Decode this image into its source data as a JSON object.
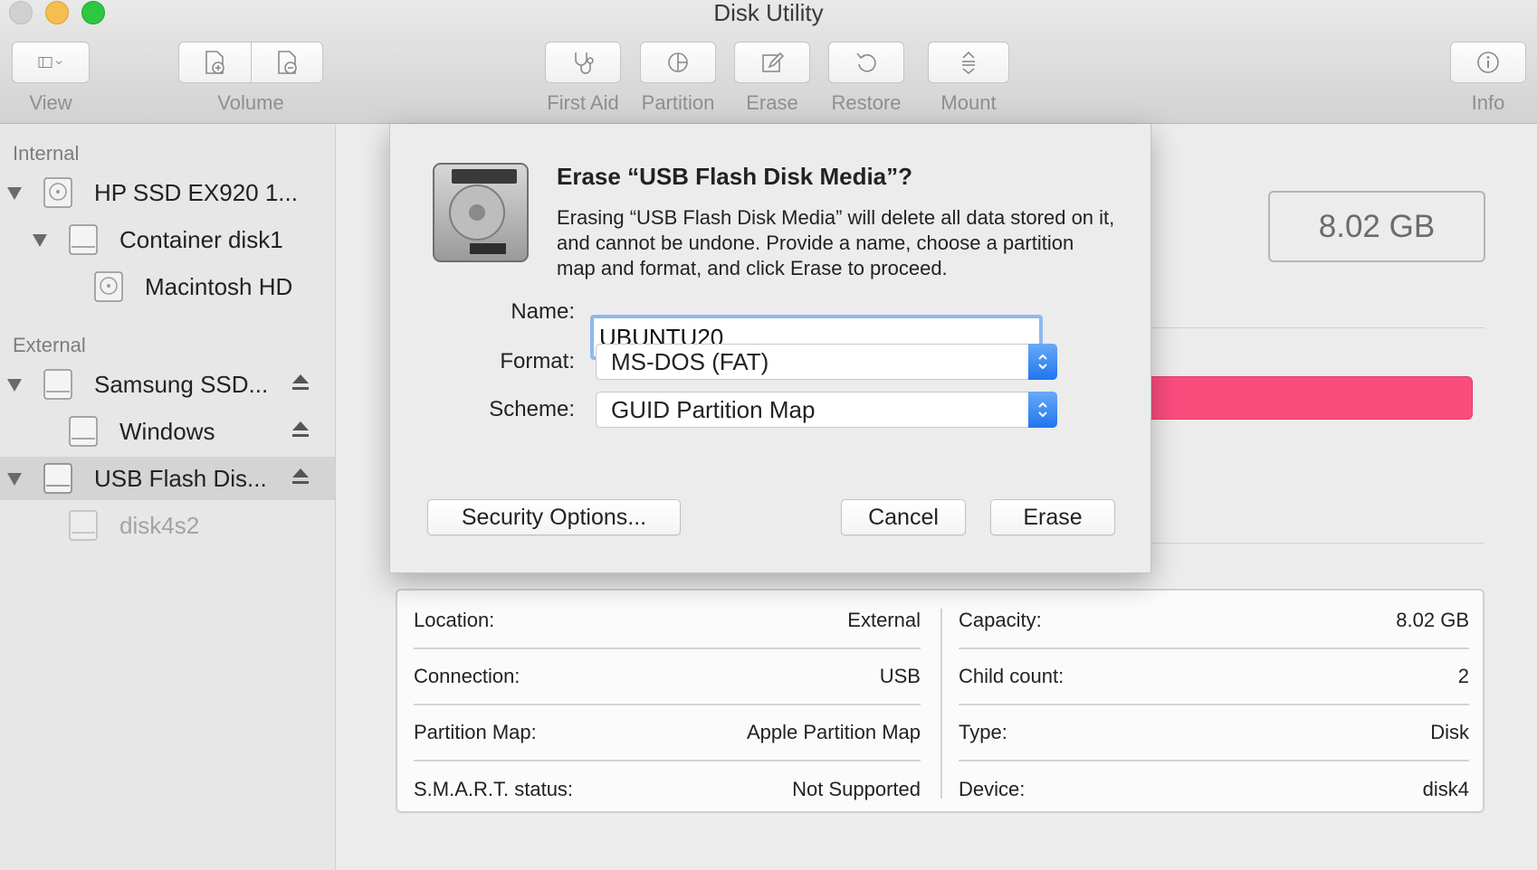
{
  "window": {
    "title": "Disk Utility"
  },
  "toolbar": {
    "view_label": "View",
    "volume_label": "Volume",
    "first_aid_label": "First Aid",
    "partition_label": "Partition",
    "erase_label": "Erase",
    "restore_label": "Restore",
    "mount_label": "Mount",
    "info_label": "Info"
  },
  "sidebar": {
    "internal_header": "Internal",
    "external_header": "External",
    "items": [
      {
        "label": "HP SSD EX920 1..."
      },
      {
        "label": "Container disk1"
      },
      {
        "label": "Macintosh HD"
      },
      {
        "label": "Samsung SSD..."
      },
      {
        "label": "Windows"
      },
      {
        "label": "USB Flash Dis..."
      },
      {
        "label": "disk4s2"
      }
    ]
  },
  "main": {
    "capacity_display": "8.02 GB",
    "info": {
      "left": [
        {
          "key": "Location:",
          "value": "External"
        },
        {
          "key": "Connection:",
          "value": "USB"
        },
        {
          "key": "Partition Map:",
          "value": "Apple Partition Map"
        },
        {
          "key": "S.M.A.R.T. status:",
          "value": "Not Supported"
        }
      ],
      "right": [
        {
          "key": "Capacity:",
          "value": "8.02 GB"
        },
        {
          "key": "Child count:",
          "value": "2"
        },
        {
          "key": "Type:",
          "value": "Disk"
        },
        {
          "key": "Device:",
          "value": "disk4"
        }
      ]
    }
  },
  "dialog": {
    "title": "Erase “USB Flash Disk Media”?",
    "message": "Erasing “USB Flash Disk Media” will delete all data stored on it, and cannot be undone. Provide a name, choose a partition map and format, and click Erase to proceed.",
    "name_label": "Name:",
    "name_value": "UBUNTU20",
    "format_label": "Format:",
    "format_value": "MS-DOS (FAT)",
    "scheme_label": "Scheme:",
    "scheme_value": "GUID Partition Map",
    "security_button": "Security Options...",
    "cancel_button": "Cancel",
    "erase_button": "Erase"
  },
  "colors": {
    "usage_bar": "#fb4c7e",
    "accent_blue": "#1f75ee",
    "focus_ring": "#8fb7ef"
  }
}
